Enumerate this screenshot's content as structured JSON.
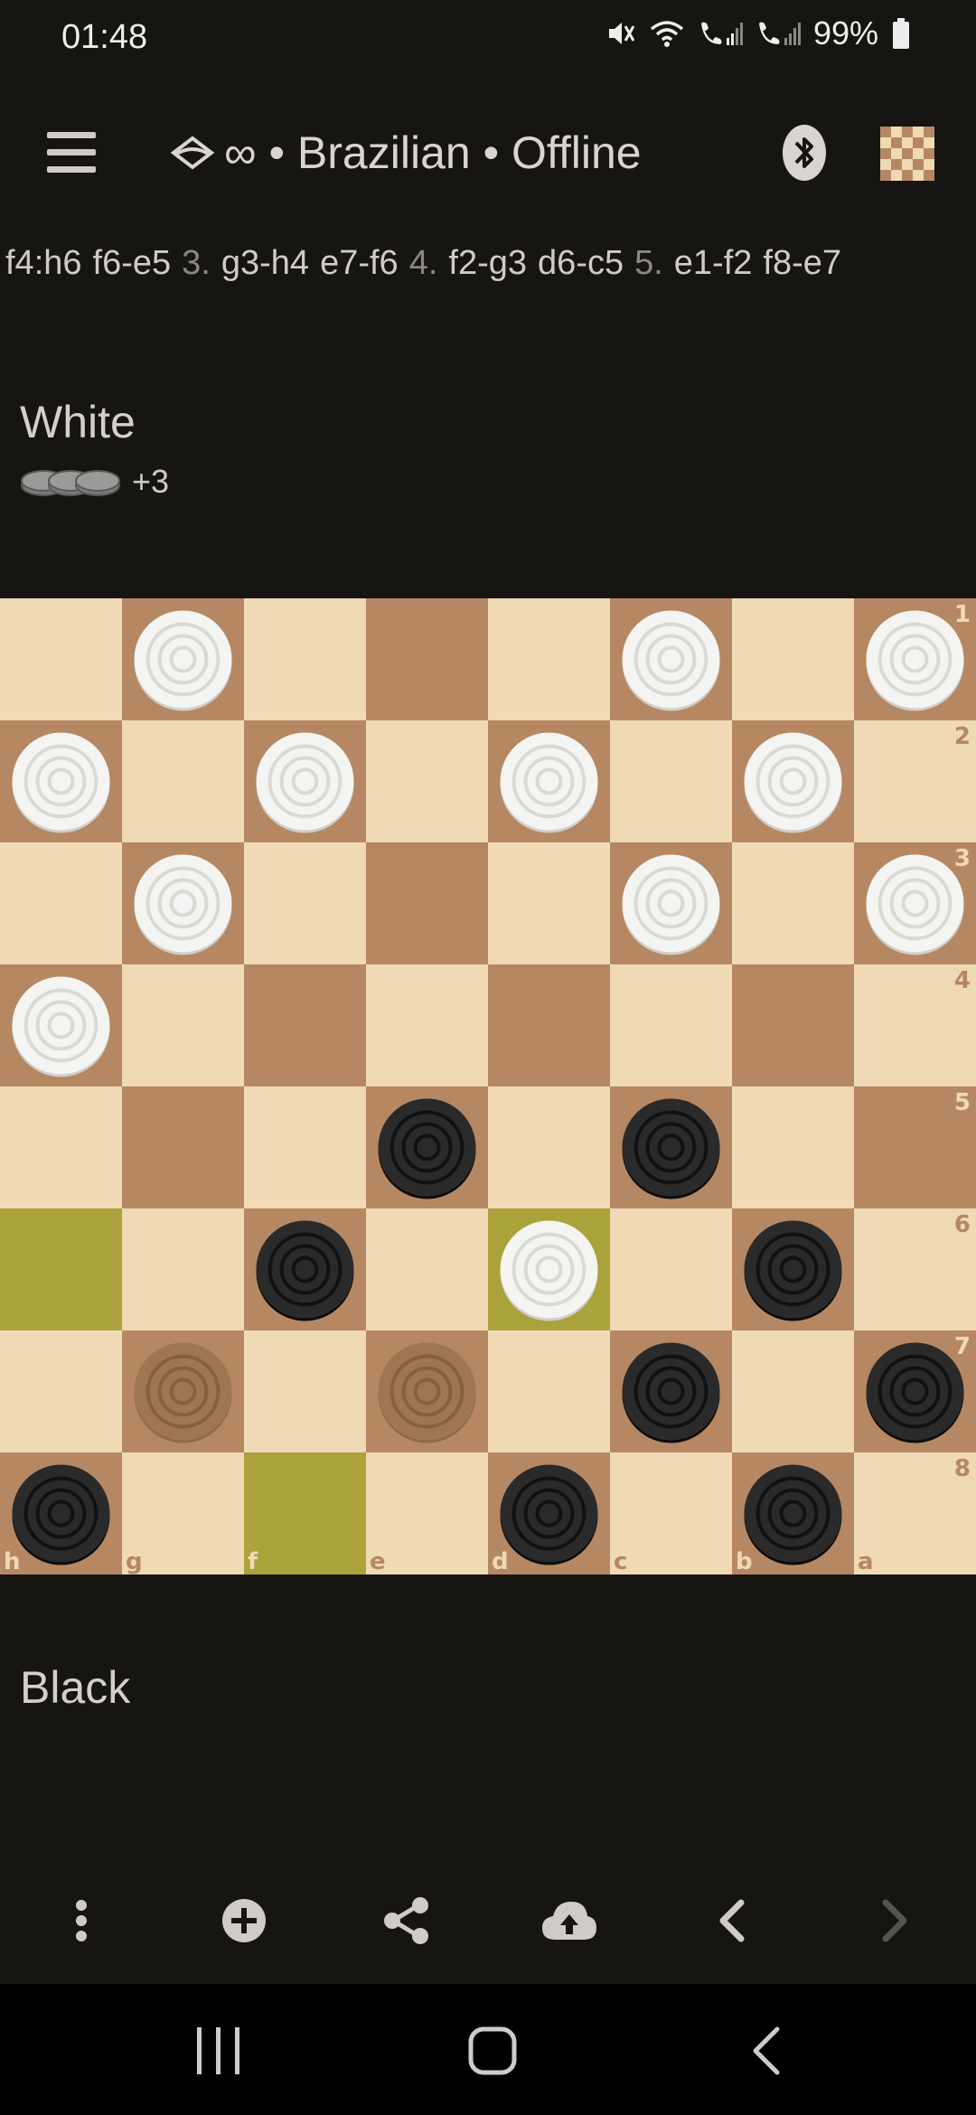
{
  "status_bar": {
    "time": "01:48",
    "battery": "99%"
  },
  "app_bar": {
    "title": "∞ • Brazilian • Offline",
    "icons": [
      "menu-icon",
      "variant-icon",
      "bluetooth-icon",
      "board-icon"
    ]
  },
  "moves": [
    {
      "text": "f4:h6",
      "kind": "move"
    },
    {
      "text": "f6-e5",
      "kind": "move"
    },
    {
      "text": "3.",
      "kind": "num"
    },
    {
      "text": "g3-h4",
      "kind": "move"
    },
    {
      "text": "e7-f6",
      "kind": "move"
    },
    {
      "text": "4.",
      "kind": "num"
    },
    {
      "text": "f2-g3",
      "kind": "move"
    },
    {
      "text": "d6-c5",
      "kind": "move"
    },
    {
      "text": "5.",
      "kind": "num"
    },
    {
      "text": "e1-f2",
      "kind": "move"
    },
    {
      "text": "f8-e7",
      "kind": "move"
    }
  ],
  "players": {
    "top": {
      "name": "White",
      "material_diff": "+3"
    },
    "bottom": {
      "name": "Black"
    }
  },
  "board": {
    "colors": {
      "light": "#f0d9b5",
      "dark": "#b58863",
      "highlight": "#aaa23a"
    },
    "rank_labels": [
      "1",
      "2",
      "3",
      "4",
      "5",
      "6",
      "7",
      "8"
    ],
    "file_labels": [
      "h",
      "g",
      "f",
      "e",
      "d",
      "c",
      "b",
      "a"
    ],
    "highlights": [
      [
        5,
        0
      ],
      [
        5,
        4
      ],
      [
        7,
        2
      ]
    ],
    "pieces": [
      {
        "row": 0,
        "col": 1,
        "color": "white"
      },
      {
        "row": 0,
        "col": 5,
        "color": "white"
      },
      {
        "row": 0,
        "col": 7,
        "color": "white"
      },
      {
        "row": 1,
        "col": 0,
        "color": "white"
      },
      {
        "row": 1,
        "col": 2,
        "color": "white"
      },
      {
        "row": 1,
        "col": 4,
        "color": "white"
      },
      {
        "row": 1,
        "col": 6,
        "color": "white"
      },
      {
        "row": 2,
        "col": 1,
        "color": "white"
      },
      {
        "row": 2,
        "col": 5,
        "color": "white"
      },
      {
        "row": 2,
        "col": 7,
        "color": "white"
      },
      {
        "row": 3,
        "col": 0,
        "color": "white"
      },
      {
        "row": 4,
        "col": 3,
        "color": "black"
      },
      {
        "row": 4,
        "col": 5,
        "color": "black"
      },
      {
        "row": 5,
        "col": 2,
        "color": "black"
      },
      {
        "row": 5,
        "col": 4,
        "color": "white"
      },
      {
        "row": 5,
        "col": 6,
        "color": "black"
      },
      {
        "row": 6,
        "col": 1,
        "color": "ghost"
      },
      {
        "row": 6,
        "col": 3,
        "color": "ghost"
      },
      {
        "row": 6,
        "col": 5,
        "color": "black"
      },
      {
        "row": 6,
        "col": 7,
        "color": "black"
      },
      {
        "row": 7,
        "col": 0,
        "color": "black"
      },
      {
        "row": 7,
        "col": 4,
        "color": "black"
      },
      {
        "row": 7,
        "col": 6,
        "color": "black"
      }
    ]
  },
  "toolbar": {
    "icons": [
      "more-vert-icon",
      "add-circle-icon",
      "share-icon",
      "cloud-upload-icon",
      "chevron-left-icon",
      "chevron-right-icon"
    ]
  },
  "nav_bar": {
    "icons": [
      "recent-apps-icon",
      "home-icon",
      "back-icon"
    ]
  }
}
